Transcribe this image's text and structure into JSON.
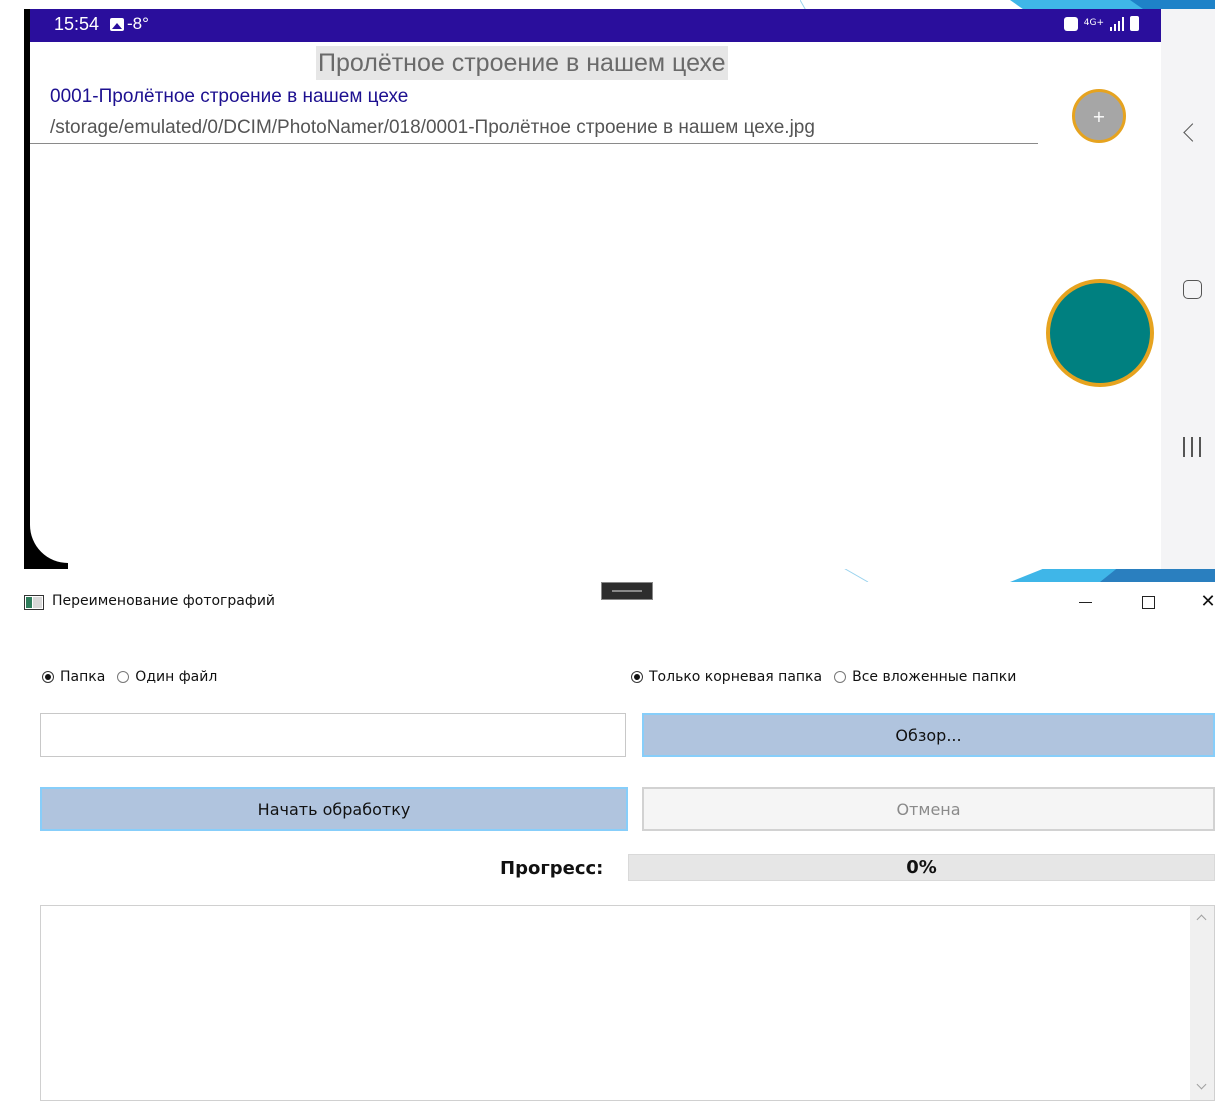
{
  "android": {
    "status": {
      "time": "15:54",
      "temp": "-8°",
      "net": "4G+"
    },
    "app_title": "Пролётное строение в нашем цехе",
    "items": [
      {
        "name": "0001-Пролётное строение в нашем цехе",
        "path": "/storage/emulated/0/DCIM/PhotoNamer/018/0001-Пролётное строение в нашем цехе.jpg"
      }
    ],
    "fab_small_label": "+",
    "colors": {
      "statusbar": "#2a0e9c",
      "fab_big": "#008080",
      "fab_border": "#e6a31f"
    }
  },
  "window": {
    "title": "Переименование фотографий",
    "controls": {
      "minimize": "–",
      "maximize": "□",
      "close": "✕"
    },
    "source_mode": {
      "options": [
        "Папка",
        "Один файл"
      ],
      "selected": 0
    },
    "scope_mode": {
      "options": [
        "Только корневая папка",
        "Все вложенные папки"
      ],
      "selected": 0
    },
    "path_value": "",
    "browse_label": "Обзор...",
    "start_label": "Начать обработку",
    "cancel_label": "Отмена",
    "progress": {
      "label": "Прогресс:",
      "value": 0,
      "text": "0%"
    },
    "log_text": ""
  }
}
